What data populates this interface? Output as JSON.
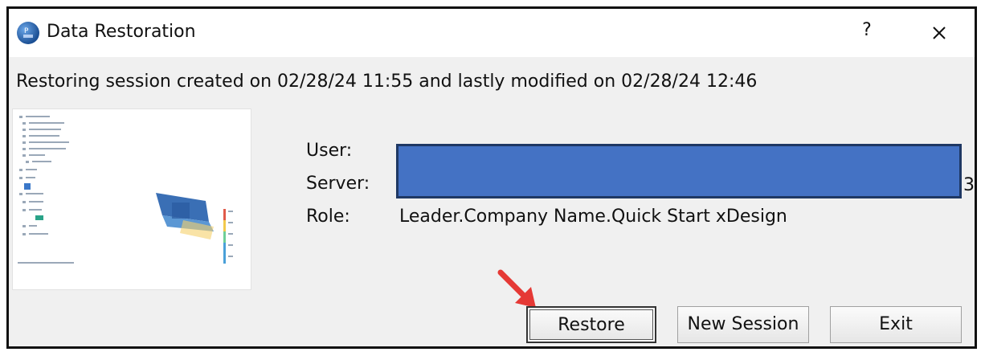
{
  "window": {
    "title": "Data Restoration",
    "help_label": "?",
    "close_icon": "close-icon",
    "app_icon": "3dexperience-compass-icon"
  },
  "message": "Restoring session created on 02/28/24 11:55 and lastly modified on 02/28/24 12:46",
  "details": {
    "user_label": "User:",
    "server_label": "Server:",
    "role_label": "Role:",
    "role_value": "Leader.Company Name.Quick Start xDesign",
    "server_value_partial": "3"
  },
  "buttons": {
    "restore": "Restore",
    "new_session": "New Session",
    "exit": "Exit"
  },
  "annotation": {
    "arrow_color": "#e53935"
  },
  "colors": {
    "redaction_fill": "#4472c4",
    "redaction_border": "#1f3864"
  }
}
